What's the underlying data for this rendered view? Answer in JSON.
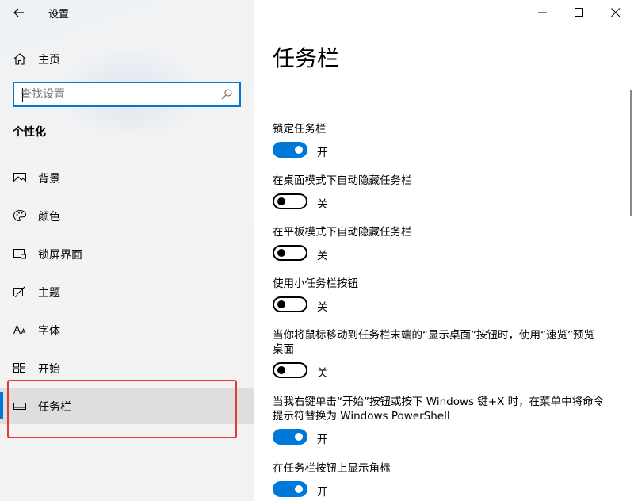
{
  "window": {
    "app_title": "设置",
    "controls": [
      "minimize",
      "maximize",
      "close"
    ]
  },
  "sidebar": {
    "home_label": "主页",
    "search_placeholder": "查找设置",
    "section_title": "个性化",
    "items": [
      {
        "label": "背景",
        "icon": "image-icon"
      },
      {
        "label": "颜色",
        "icon": "palette-icon"
      },
      {
        "label": "锁屏界面",
        "icon": "lock-screen-icon"
      },
      {
        "label": "主题",
        "icon": "theme-brush-icon"
      },
      {
        "label": "字体",
        "icon": "font-icon"
      },
      {
        "label": "开始",
        "icon": "start-grid-icon"
      },
      {
        "label": "任务栏",
        "icon": "taskbar-icon",
        "selected": true
      }
    ]
  },
  "main": {
    "page_title": "任务栏",
    "settings": [
      {
        "label": "锁定任务栏",
        "on": true,
        "state": "开"
      },
      {
        "label": "在桌面模式下自动隐藏任务栏",
        "on": false,
        "state": "关"
      },
      {
        "label": "在平板模式下自动隐藏任务栏",
        "on": false,
        "state": "关"
      },
      {
        "label": "使用小任务栏按钮",
        "on": false,
        "state": "关"
      },
      {
        "label_lines": [
          "当你将鼠标移动到任务栏末端的“显示桌面”按钮时，使用“速览”预览",
          "桌面"
        ],
        "on": false,
        "state": "关"
      },
      {
        "label_lines": [
          "当我右键单击“开始”按钮或按下 Windows 键+X 时，在菜单中将命令",
          "提示符替换为 Windows PowerShell"
        ],
        "on": true,
        "state": "开"
      },
      {
        "label": "在任务栏按钮上显示角标",
        "on": true,
        "state": "开"
      }
    ]
  },
  "colors": {
    "accent": "#0078d7",
    "highlight": "#e53935",
    "sidebar_bg": "#f2f2f2"
  }
}
